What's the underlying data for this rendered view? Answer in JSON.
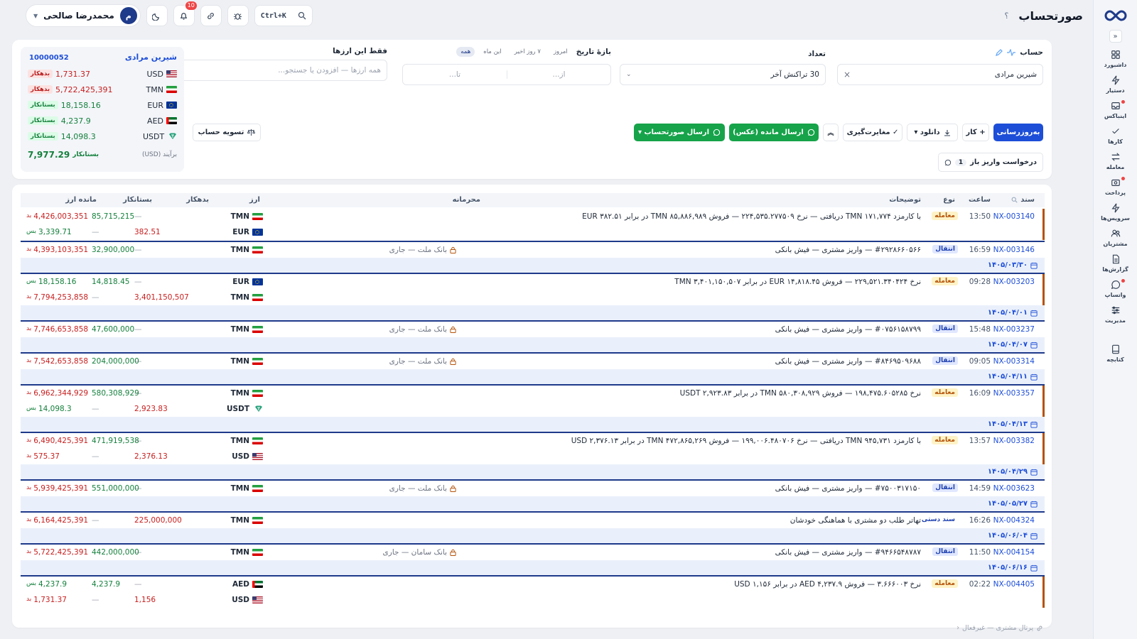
{
  "app": {
    "title": "صورتحساب",
    "help": "؟"
  },
  "user": {
    "name": "محمدرضا صالحی",
    "avatar_letter": "م"
  },
  "topbar": {
    "search_shortcut": "Ctrl+K",
    "notifications_count": "10"
  },
  "sidebar": {
    "items": [
      {
        "label": "داشبورد",
        "icon": "dashboard-icon"
      },
      {
        "label": "دستیار",
        "icon": "bolt-icon"
      },
      {
        "label": "اینباکس",
        "icon": "inbox-icon"
      },
      {
        "label": "کارها",
        "icon": "check-icon"
      },
      {
        "label": "معامله",
        "icon": "swap-icon"
      },
      {
        "label": "پرداخت",
        "icon": "payment-icon"
      },
      {
        "label": "سرویس‌ها",
        "icon": "bolt-icon"
      },
      {
        "label": "مشتریان",
        "icon": "users-icon"
      },
      {
        "label": "گزارش‌ها",
        "icon": "report-icon"
      },
      {
        "label": "واتساپ",
        "icon": "chat-icon"
      },
      {
        "label": "مدیریت",
        "icon": "sliders-icon"
      },
      {
        "label": "کتابچه",
        "icon": "book-icon"
      }
    ]
  },
  "filters": {
    "account_label": "حساب",
    "account_value": "شیرین مرادی",
    "count_label": "تعداد",
    "count_value": "30 تراکنش آخر",
    "date_label": "بازهٔ تاریخ",
    "date_chips": [
      "امروز",
      "۷ روز اخیر",
      "این ماه",
      "همه"
    ],
    "date_from_placeholder": "از...",
    "date_to_placeholder": "تا...",
    "currencies_label": "فقط این ارزها",
    "currencies_placeholder": "همه ارزها — افزودن یا جستجو..."
  },
  "actions": {
    "refresh": "به‌روزرسانی",
    "add_task": "+ کار",
    "download": "دانلود ▾",
    "discrepancy": "✓ مغایرت‌گیری",
    "send_balance": "ارسال مانده (عکس)",
    "send_statement": "ارسال صورتحساب ▾",
    "settle": "تسویه حساب",
    "open_deposit": "درخواست واریز باز",
    "open_deposit_count": "1"
  },
  "summary": {
    "name": "شیرین مرادی",
    "id": "10000052",
    "rows": [
      {
        "cur": "USD",
        "amount": "1,731.37",
        "status": "بدهکار",
        "kind": "debt"
      },
      {
        "cur": "TMN",
        "amount": "5,722,425,391",
        "status": "بدهکار",
        "kind": "debt"
      },
      {
        "cur": "EUR",
        "amount": "18,158.16",
        "status": "بستانکار",
        "kind": "cred"
      },
      {
        "cur": "AED",
        "amount": "4,237.9",
        "status": "بستانکار",
        "kind": "cred"
      },
      {
        "cur": "USDT",
        "amount": "14,098.3",
        "status": "بستانکار",
        "kind": "cred"
      }
    ],
    "net_label": "برآیند (USD)",
    "net_status": "بستانکار",
    "net_value": "7,977.29"
  },
  "table": {
    "headers": {
      "doc": "سند",
      "time": "ساعت",
      "type": "نوع",
      "desc": "توضیحات",
      "confidential": "محرمانه",
      "currency": "ارز",
      "debit": "بدهکار",
      "credit": "بستانکار",
      "balance": "مانده ارز"
    },
    "groups": [
      {
        "doc": "NX-003140",
        "time": "13:50",
        "type": "معامله",
        "kind": "trade",
        "desc": "با کارمزد TMN ۱۷۱,۷۷۴ دریافتی — نرخ ۲۲۴,۵۳۵.۲۷۷۵۰۹ — فروش TMN ۸۵,۸۸۶,۹۸۹ در برابر EUR ۳۸۲.۵۱",
        "conf": "",
        "lines": [
          {
            "cur": "TMN",
            "debit": "—",
            "credit": "85,715,215",
            "bal": "4,426,003,351",
            "bal_tag": "بد",
            "bal_kind": "debt"
          },
          {
            "cur": "EUR",
            "debit": "382.51",
            "credit": "—",
            "bal": "3,339.71",
            "bal_tag": "بس",
            "bal_kind": "cred"
          }
        ],
        "date": ""
      },
      {
        "doc": "NX-003146",
        "time": "16:59",
        "type": "انتقال",
        "kind": "xfer",
        "desc": "#۲۹۲۸۶۶۰۵۶۶ — واریز مشتری — فیش بانکی",
        "conf": "بانک ملت — جاری",
        "lines": [
          {
            "cur": "TMN",
            "debit": "—",
            "credit": "32,900,000",
            "bal": "4,393,103,351",
            "bal_tag": "بد",
            "bal_kind": "debt"
          }
        ],
        "date": "۱۴۰۵/۰۳/۳۰"
      },
      {
        "doc": "NX-003203",
        "time": "09:28",
        "type": "معامله",
        "kind": "trade",
        "desc": "نرخ ۲۲۹,۵۲۱.۳۴۰۴۲۴ — فروش EUR ۱۴,۸۱۸.۴۵ در برابر TMN ۳,۴۰۱,۱۵۰,۵۰۷",
        "conf": "",
        "lines": [
          {
            "cur": "EUR",
            "debit": "—",
            "credit": "14,818.45",
            "bal": "18,158.16",
            "bal_tag": "بس",
            "bal_kind": "cred"
          },
          {
            "cur": "TMN",
            "debit": "3,401,150,507",
            "credit": "—",
            "bal": "7,794,253,858",
            "bal_tag": "بد",
            "bal_kind": "debt"
          }
        ],
        "date": "۱۴۰۵/۰۴/۰۱"
      },
      {
        "doc": "NX-003237",
        "time": "15:48",
        "type": "انتقال",
        "kind": "xfer",
        "desc": "#۰۷۵۶۱۵۸۷۹۹ — واریز مشتری — فیش بانکی",
        "conf": "بانک ملت — جاری",
        "lines": [
          {
            "cur": "TMN",
            "debit": "—",
            "credit": "47,600,000",
            "bal": "7,746,653,858",
            "bal_tag": "بد",
            "bal_kind": "debt"
          }
        ],
        "date": "۱۴۰۵/۰۴/۰۷"
      },
      {
        "doc": "NX-003314",
        "time": "09:05",
        "type": "انتقال",
        "kind": "xfer",
        "desc": "#۸۴۶۹۵۰۹۶۸۸ — واریز مشتری — فیش بانکی",
        "conf": "بانک ملت — جاری",
        "lines": [
          {
            "cur": "TMN",
            "debit": "—",
            "credit": "204,000,000",
            "bal": "7,542,653,858",
            "bal_tag": "بد",
            "bal_kind": "debt"
          }
        ],
        "date": "۱۴۰۵/۰۴/۱۱"
      },
      {
        "doc": "NX-003357",
        "time": "16:09",
        "type": "معامله",
        "kind": "trade",
        "desc": "نرخ ۱۹۸,۴۷۵.۶۰۵۲۸۵ — فروش TMN ۵۸۰,۳۰۸,۹۲۹ در برابر USDT ۲,۹۲۳.۸۳",
        "conf": "",
        "lines": [
          {
            "cur": "TMN",
            "debit": "—",
            "credit": "580,308,929",
            "bal": "6,962,344,929",
            "bal_tag": "بد",
            "bal_kind": "debt"
          },
          {
            "cur": "USDT",
            "debit": "2,923.83",
            "credit": "—",
            "bal": "14,098.3",
            "bal_tag": "بس",
            "bal_kind": "cred"
          }
        ],
        "date": "۱۴۰۵/۰۴/۱۳"
      },
      {
        "doc": "NX-003382",
        "time": "13:57",
        "type": "معامله",
        "kind": "trade",
        "desc": "با کارمزد TMN ۹۴۵,۷۳۱ دریافتی — نرخ ۱۹۹,۰۰۶.۴۸۰۷۰۶ — فروش TMN ۴۷۲,۸۶۵,۲۶۹ در برابر USD ۲,۳۷۶.۱۳",
        "conf": "",
        "lines": [
          {
            "cur": "TMN",
            "debit": "—",
            "credit": "471,919,538",
            "bal": "6,490,425,391",
            "bal_tag": "بد",
            "bal_kind": "debt"
          },
          {
            "cur": "USD",
            "debit": "2,376.13",
            "credit": "—",
            "bal": "575.37",
            "bal_tag": "بد",
            "bal_kind": "debt"
          }
        ],
        "date": "۱۴۰۵/۰۴/۲۹"
      },
      {
        "doc": "NX-003623",
        "time": "14:59",
        "type": "انتقال",
        "kind": "xfer",
        "desc": "#۷۵۰۰۳۱۷۱۵۰ — واریز مشتری — فیش بانکی",
        "conf": "بانک ملت — جاری",
        "lines": [
          {
            "cur": "TMN",
            "debit": "—",
            "credit": "551,000,000",
            "bal": "5,939,425,391",
            "bal_tag": "بد",
            "bal_kind": "debt"
          }
        ],
        "date": "۱۴۰۵/۰۵/۲۷"
      },
      {
        "doc": "NX-004324",
        "time": "16:26",
        "type": "سند دستی",
        "kind": "manual",
        "desc": "تهاتر طلب دو مشتری با هماهنگی خودشان",
        "conf": "",
        "lines": [
          {
            "cur": "TMN",
            "debit": "225,000,000",
            "credit": "—",
            "bal": "6,164,425,391",
            "bal_tag": "بد",
            "bal_kind": "debt"
          }
        ],
        "date": "۱۴۰۵/۰۶/۰۴"
      },
      {
        "doc": "NX-004154",
        "time": "11:50",
        "type": "انتقال",
        "kind": "xfer",
        "desc": "#۹۴۶۶۵۴۸۷۸۷ — واریز مشتری — فیش بانکی",
        "conf": "بانک سامان — جاری",
        "lines": [
          {
            "cur": "TMN",
            "debit": "—",
            "credit": "442,000,000",
            "bal": "5,722,425,391",
            "bal_tag": "بد",
            "bal_kind": "debt"
          }
        ],
        "date": "۱۴۰۵/۰۶/۱۶"
      },
      {
        "doc": "NX-004405",
        "time": "02:22",
        "type": "معامله",
        "kind": "trade",
        "desc": "نرخ ۳.۶۶۶۰۰۳ — فروش AED ۴,۲۳۷.۹ در برابر USD ۱,۱۵۶",
        "conf": "",
        "lines": [
          {
            "cur": "AED",
            "debit": "—",
            "credit": "4,237.9",
            "bal": "4,237.9",
            "bal_tag": "بس",
            "bal_kind": "cred"
          },
          {
            "cur": "USD",
            "debit": "1,156",
            "credit": "—",
            "bal": "1,731.37",
            "bal_tag": "بد",
            "bal_kind": "debt"
          }
        ],
        "date": ""
      }
    ]
  },
  "footer": {
    "portal_note": "پرتال مشتری — غیرفعال"
  },
  "colors": {
    "primary": "#1d4ed8",
    "whatsapp": "#16a34a",
    "debt": "#c81e1e",
    "credit": "#15803d",
    "trade_accent": "#b45309"
  }
}
